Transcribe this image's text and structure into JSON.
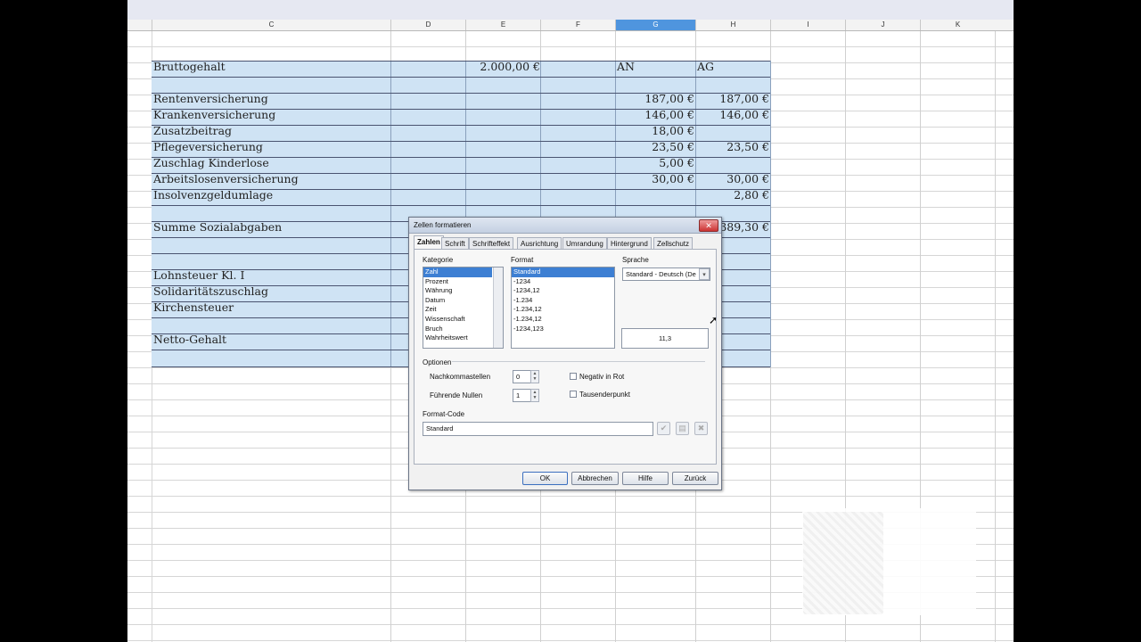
{
  "columns": [
    "C",
    "D",
    "E",
    "F",
    "G",
    "H",
    "I",
    "J",
    "K"
  ],
  "selected_column": "G",
  "sheet": {
    "bruttogehalt": {
      "label": "Bruttogehalt",
      "value": "2.000,00 €",
      "an": "AN",
      "ag": "AG"
    },
    "rows": [
      {
        "label": "Rentenversicherung",
        "an": "187,00 €",
        "ag": "187,00 €"
      },
      {
        "label": "Krankenversicherung",
        "an": "146,00 €",
        "ag": "146,00 €"
      },
      {
        "label": "Zusatzbeitrag",
        "an": "18,00 €",
        "ag": ""
      },
      {
        "label": "Pflegeversicherung",
        "an": "23,50 €",
        "ag": "23,50 €"
      },
      {
        "label": "Zuschlag Kinderlose",
        "an": "5,00 €",
        "ag": ""
      },
      {
        "label": "Arbeitslosenversicherung",
        "an": "30,00 €",
        "ag": "30,00 €"
      },
      {
        "label": "Insolvenzgeldumlage",
        "an": "",
        "ag": "2,80 €"
      }
    ],
    "summe": {
      "label": "Summe Sozialabgaben",
      "ag": "389,30 €"
    },
    "lohnsteuer": "Lohnsteuer Kl. I",
    "soli": "Solidaritätszuschlag",
    "kirchensteuer": "Kirchensteuer",
    "netto": "Netto-Gehalt"
  },
  "dialog": {
    "title": "Zellen formatieren",
    "close": "✕",
    "tabs": [
      "Zahlen",
      "Schrift",
      "Schrifteffekt",
      "Ausrichtung",
      "Umrandung",
      "Hintergrund",
      "Zellschutz"
    ],
    "active_tab": "Zahlen",
    "kategorie_label": "Kategorie",
    "kategorien": [
      "Zahl",
      "Prozent",
      "Währung",
      "Datum",
      "Zeit",
      "Wissenschaft",
      "Bruch",
      "Wahrheitswert"
    ],
    "format_label": "Format",
    "formate": [
      "Standard",
      "-1234",
      "-1234,12",
      "-1.234",
      "-1.234,12",
      "-1.234,12",
      "-1234,123"
    ],
    "sprache_label": "Sprache",
    "sprache_value": "Standard - Deutsch (De",
    "preview": "11,3",
    "optionen_label": "Optionen",
    "nachkommastellen_label": "Nachkommastellen",
    "nachkommastellen_value": "0",
    "fuehrende_nullen_label": "Führende Nullen",
    "fuehrende_nullen_value": "1",
    "negativ_label": "Negativ in Rot",
    "tausender_label": "Tausenderpunkt",
    "format_code_label": "Format-Code",
    "format_code_value": "Standard",
    "buttons": {
      "ok": "OK",
      "abbrechen": "Abbrechen",
      "hilfe": "Hilfe",
      "zurueck": "Zurück"
    }
  }
}
